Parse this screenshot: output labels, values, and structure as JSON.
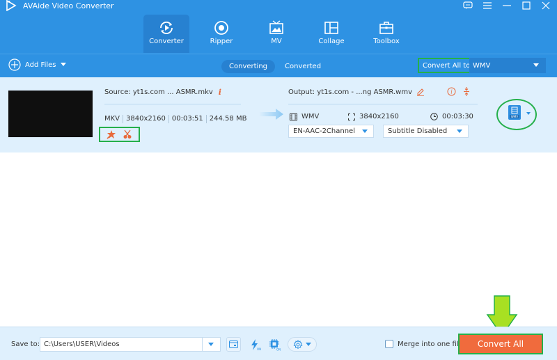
{
  "app": {
    "title": "AVAide Video Converter",
    "window_controls": [
      "feedback-icon",
      "menu-icon",
      "minimize-icon",
      "maximize-icon",
      "close-icon"
    ]
  },
  "nav": {
    "tabs": [
      {
        "label": "Converter",
        "icon": "convert-icon",
        "active": true
      },
      {
        "label": "Ripper",
        "icon": "disc-icon",
        "active": false
      },
      {
        "label": "MV",
        "icon": "tv-icon",
        "active": false
      },
      {
        "label": "Collage",
        "icon": "collage-icon",
        "active": false
      },
      {
        "label": "Toolbox",
        "icon": "toolbox-icon",
        "active": false
      }
    ]
  },
  "toolbar": {
    "add_files": "Add Files",
    "segments": [
      {
        "label": "Converting",
        "active": true
      },
      {
        "label": "Converted",
        "active": false
      }
    ],
    "convert_all_to_label": "Convert All to:",
    "convert_all_to_value": "WMV"
  },
  "file": {
    "source_name": "Source: yt1s.com ... ASMR.mkv",
    "source_meta": [
      "MKV",
      "3840x2160",
      "00:03:51",
      "244.58 MB"
    ],
    "output_name": "Output: yt1s.com - ...ng ASMR.wmv",
    "output_format": "WMV",
    "output_resolution": "3840x2160",
    "output_duration": "00:03:30",
    "audio_track": "EN-AAC-2Channel",
    "subtitle": "Subtitle Disabled",
    "format_badge": "WMV"
  },
  "bottom": {
    "save_to_label": "Save to:",
    "save_path": "C:\\Users\\USER\\Videos",
    "merge_label": "Merge into one file",
    "merge_checked": false,
    "convert_all": "Convert All"
  },
  "colors": {
    "header": "#2e92e3",
    "accent_orange": "#f06b3d",
    "highlight_green": "#25b04b",
    "arrow_green": "#a8e022"
  }
}
